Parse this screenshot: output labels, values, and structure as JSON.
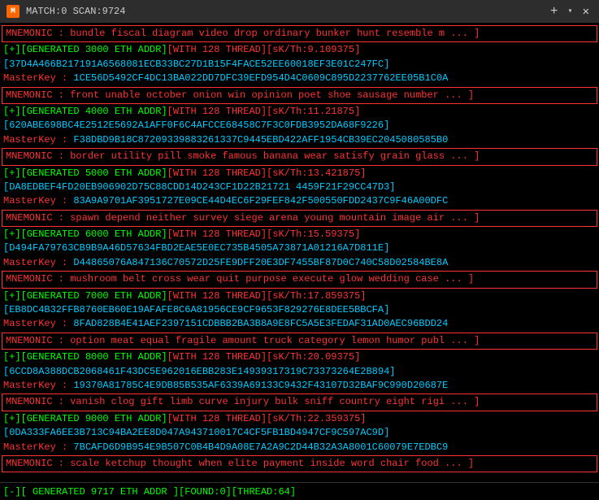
{
  "titleBar": {
    "icon": "M",
    "text": "MATCH:0 SCAN:9724",
    "closeLabel": "✕",
    "newTabLabel": "+",
    "dropdownLabel": "▾"
  },
  "statusBar": {
    "text": "[-][ GENERATED 9717 ETH ADDR ][FOUND:0][THREAD:64]"
  },
  "lines": [
    {
      "type": "mnemonic",
      "text": "MNEMONIC : bundle fiscal diagram video drop ordinary bunker hunt resemble m ... ]"
    },
    {
      "type": "generated",
      "text": "[+][GENERATED 3000 ETH ADDR][WITH 128 THREAD][sK/Th:9.109375]"
    },
    {
      "type": "addr",
      "text": "[37D4A466B217191A6568081ECB33BC27D1B15F4FACE52EE60018EF3E01C247FC]"
    },
    {
      "type": "masterkey",
      "text": "MasterKey : 1CE56D5492CF4DC13BA022DD7DFC39EFD954D4C0609C895D2237762EE05B1C0A"
    },
    {
      "type": "mnemonic",
      "text": "MNEMONIC : front unable october onion win opinion poet shoe sausage number ... ]"
    },
    {
      "type": "generated",
      "text": "[+][GENERATED 4000 ETH ADDR][WITH 128 THREAD][sK/Th:11.21875]"
    },
    {
      "type": "addr",
      "text": "[620ABE698BC4E2512E5692A1AFF0F6C4AFCCE68458C7F3C0FDB3952DA68F9226]"
    },
    {
      "type": "masterkey",
      "text": "MasterKey : F38DBD9B18C87209339883261337C9445EBD422AFF1954CB39EC2045080585B0"
    },
    {
      "type": "mnemonic",
      "text": "MNEMONIC : border utility pill smoke famous banana wear satisfy grain glass ... ]"
    },
    {
      "type": "generated",
      "text": "[+][GENERATED 5000 ETH ADDR][WITH 128 THREAD][sK/Th:13.421875]"
    },
    {
      "type": "addr",
      "text": "[DA8EDBEF4FD20EB906902D75C88CDD14D243CF1D22B21721 4459F21F29CC47D3]"
    },
    {
      "type": "masterkey",
      "text": "MasterKey : 83A9A9701AF3951727E09CE44D4EC6F29FEF842F500550FDD2437C9F46A00DFC"
    },
    {
      "type": "mnemonic",
      "text": "MNEMONIC : spawn depend neither survey siege arena young mountain image air ... ]"
    },
    {
      "type": "generated",
      "text": "[+][GENERATED 6000 ETH ADDR][WITH 128 THREAD][sK/Th:15.59375]"
    },
    {
      "type": "addr",
      "text": "[D494FA79763CB9B9A46D57634FBD2EAE5E0EC735B4505A73871A01216A7D811E]"
    },
    {
      "type": "masterkey",
      "text": "MasterKey : D44865076A847136C70572D25FE9DFF20E3DF7455BF87D0C740C58D02584BE8A"
    },
    {
      "type": "mnemonic",
      "text": "MNEMONIC : mushroom belt cross wear quit purpose execute glow wedding case ... ]"
    },
    {
      "type": "generated",
      "text": "[+][GENERATED 7000 ETH ADDR][WITH 128 THREAD][sK/Th:17.859375]"
    },
    {
      "type": "addr",
      "text": "[EB8DC4B32FFB8760EB60E19AFAFE8C6A81956CE9CF9653F829276E8DEE5BBCFA]"
    },
    {
      "type": "masterkey",
      "text": "MasterKey : 8FAD828B4E41AEF2397151CDBBB2BA3B8A9E8FC5A5E3FEDAF31AD0AEC96BDD24"
    },
    {
      "type": "mnemonic",
      "text": "MNEMONIC : option meat equal fragile amount truck category lemon humor publ ... ]"
    },
    {
      "type": "generated",
      "text": "[+][GENERATED 8000 ETH ADDR][WITH 128 THREAD][sK/Th:20.09375]"
    },
    {
      "type": "addr",
      "text": "[6CCD8A388DCB2068461F43DC5E962016EBB283E14939317319C73373264E2B894]"
    },
    {
      "type": "masterkey",
      "text": "MasterKey : 19370A81785C4E9DB85B535AF6339A69133C9432F43107D32BAF9C990D20687E"
    },
    {
      "type": "mnemonic",
      "text": "MNEMONIC : vanish clog gift limb curve injury bulk sniff country eight rigi ... ]"
    },
    {
      "type": "generated",
      "text": "[+][GENERATED 9000 ETH ADDR][WITH 128 THREAD][sK/Th:22.359375]"
    },
    {
      "type": "addr",
      "text": "[0DA333FA6EE3B713C94BA2EE8D047A943710017C4CF5FB1BD4947CF9C597AC9D]"
    },
    {
      "type": "masterkey",
      "text": "MasterKey : 7BCAFD6D9B954E9B507C0B4B4D9A08E7A2A9C2D44B32A3A8001C60079E7EDBC9"
    },
    {
      "type": "mnemonic",
      "text": "MNEMONIC : scale ketchup thought when elite payment inside word chair food ... ]"
    }
  ]
}
